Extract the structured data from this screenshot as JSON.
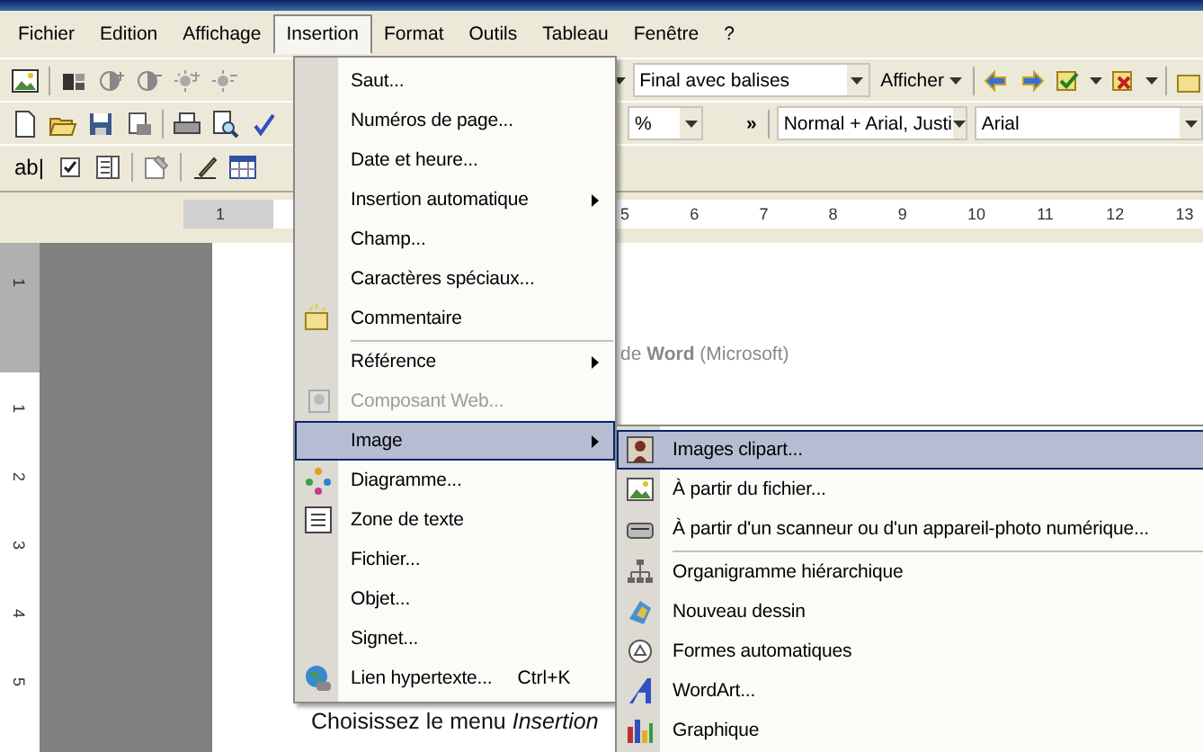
{
  "menu_bar": [
    {
      "label": "Fichier",
      "selected": false
    },
    {
      "label": "Edition",
      "selected": false
    },
    {
      "label": "Affichage",
      "selected": false
    },
    {
      "label": "Insertion",
      "selected": true
    },
    {
      "label": "Format",
      "selected": false
    },
    {
      "label": "Outils",
      "selected": false
    },
    {
      "label": "Tableau",
      "selected": false
    },
    {
      "label": "Fenêtre",
      "selected": false
    },
    {
      "label": "?",
      "selected": false
    }
  ],
  "toolbars": {
    "track_view": "Final avec balises",
    "show_button": "Afficher",
    "zoom": "%",
    "more": "»",
    "style": "Normal + Arial, Justi",
    "font": "Arial",
    "text_field": "ab|"
  },
  "ruler": {
    "left_numbers": [
      "1"
    ],
    "right_numbers": [
      "5",
      "6",
      "7",
      "8",
      "9",
      "10",
      "11",
      "12",
      "13"
    ],
    "vertical_numbers": [
      "1",
      "1",
      "2",
      "3",
      "4",
      "5"
    ]
  },
  "document": {
    "lines": [
      "de **Word** (Microsoft)",
      "Choisissez le menu *Insertion*"
    ]
  },
  "insert_menu": {
    "items": [
      {
        "label": "Saut...",
        "selected": false,
        "disabled": false,
        "submenu": false,
        "separator_before": false
      },
      {
        "label": "Numéros de page...",
        "selected": false,
        "disabled": false,
        "submenu": false,
        "separator_before": false
      },
      {
        "label": "Date et heure...",
        "selected": false,
        "disabled": false,
        "submenu": false,
        "separator_before": false
      },
      {
        "label": "Insertion automatique",
        "selected": false,
        "disabled": false,
        "submenu": true,
        "separator_before": false
      },
      {
        "label": "Champ...",
        "selected": false,
        "disabled": false,
        "submenu": false,
        "separator_before": false
      },
      {
        "label": "Caractères spéciaux...",
        "selected": false,
        "disabled": false,
        "submenu": false,
        "separator_before": false
      },
      {
        "label": "Commentaire",
        "selected": false,
        "disabled": false,
        "submenu": false,
        "separator_before": false
      },
      {
        "label": "Référence",
        "selected": false,
        "disabled": false,
        "submenu": true,
        "separator_before": true
      },
      {
        "label": "Composant Web...",
        "selected": false,
        "disabled": true,
        "submenu": false,
        "separator_before": false
      },
      {
        "label": "Image",
        "selected": true,
        "disabled": false,
        "submenu": true,
        "separator_before": false
      },
      {
        "label": "Diagramme...",
        "selected": false,
        "disabled": false,
        "submenu": false,
        "separator_before": false
      },
      {
        "label": "Zone de texte",
        "selected": false,
        "disabled": false,
        "submenu": false,
        "separator_before": false
      },
      {
        "label": "Fichier...",
        "selected": false,
        "disabled": false,
        "submenu": false,
        "separator_before": false
      },
      {
        "label": "Objet...",
        "selected": false,
        "disabled": false,
        "submenu": false,
        "separator_before": false
      },
      {
        "label": "Signet...",
        "selected": false,
        "disabled": false,
        "submenu": false,
        "separator_before": false
      },
      {
        "label": "Lien hypertexte...",
        "shortcut": "Ctrl+K",
        "selected": false,
        "disabled": false,
        "submenu": false,
        "separator_before": false
      }
    ]
  },
  "image_submenu": {
    "items": [
      {
        "label": "Images clipart...",
        "selected": true,
        "separator_before": false
      },
      {
        "label": "À partir du fichier...",
        "selected": false,
        "separator_before": false
      },
      {
        "label": "À partir d'un scanneur ou d'un appareil-photo numérique...",
        "selected": false,
        "separator_before": false
      },
      {
        "label": "Organigramme hiérarchique",
        "selected": false,
        "separator_before": true
      },
      {
        "label": "Nouveau dessin",
        "selected": false,
        "separator_before": false
      },
      {
        "label": "Formes automatiques",
        "selected": false,
        "separator_before": false
      },
      {
        "label": "WordArt...",
        "selected": false,
        "separator_before": false
      },
      {
        "label": "Graphique",
        "selected": false,
        "separator_before": false
      }
    ]
  }
}
